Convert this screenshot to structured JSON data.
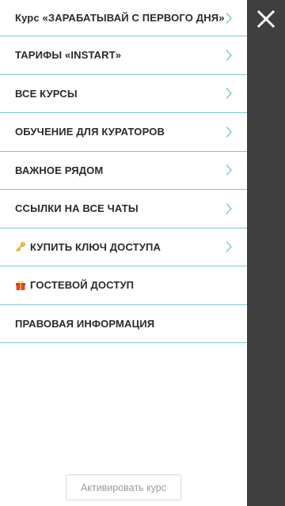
{
  "menu": {
    "items": [
      {
        "label": "Курс «ЗАРАБАТЫВАЙ С ПЕРВОГО ДНЯ»",
        "icon": "",
        "has_chevron": true
      },
      {
        "label": "ТАРИФЫ «INSTART»",
        "icon": "",
        "has_chevron": true
      },
      {
        "label": "ВСЕ КУРСЫ",
        "icon": "",
        "has_chevron": true
      },
      {
        "label": "ОБУЧЕНИЕ ДЛЯ КУРАТОРОВ",
        "icon": "",
        "has_chevron": true
      },
      {
        "label": "ВАЖНОЕ РЯДОМ",
        "icon": "",
        "has_chevron": true
      },
      {
        "label": "ССЫЛКИ НА ВСЕ ЧАТЫ",
        "icon": "",
        "has_chevron": true
      },
      {
        "label": "КУПИТЬ КЛЮЧ ДОСТУПА",
        "icon": "key-icon",
        "has_chevron": true
      },
      {
        "label": "ГОСТЕВОЙ ДОСТУП",
        "icon": "gift-icon",
        "has_chevron": false
      },
      {
        "label": "ПРАВОВАЯ ИНФОРМАЦИЯ",
        "icon": "",
        "has_chevron": false
      }
    ]
  },
  "footer": {
    "activate_label": "Активировать курс"
  },
  "close": {
    "icon": "close-icon"
  },
  "colors": {
    "divider": "#7fc5d3",
    "chevron": "#7fc5d3",
    "scrim": "#3f3f3f",
    "text": "#2a2a2a"
  }
}
